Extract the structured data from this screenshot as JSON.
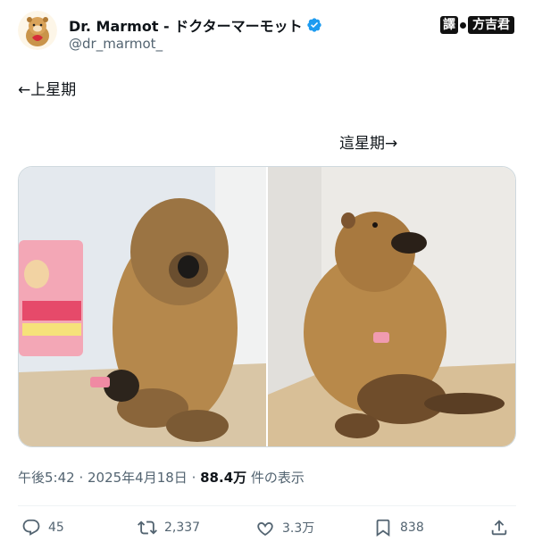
{
  "user": {
    "display_name": "Dr. Marmot - ドクターマーモット",
    "handle": "@dr_marmot_",
    "verified_icon": "verified-badge-icon"
  },
  "watermark": {
    "part1": "譯",
    "part2": "方吉君"
  },
  "tweet": {
    "line1": "←上星期",
    "line2": "這星期→"
  },
  "meta": {
    "time": "午後5:42",
    "sep1": " · ",
    "date": "2025年4月18日",
    "sep2": " · ",
    "views": "88.4万",
    "views_label": " 件の表示"
  },
  "actions": {
    "replies": "45",
    "retweets": "2,337",
    "likes": "3.3万",
    "bookmarks": "838"
  },
  "colors": {
    "accent": "#1d9bf0",
    "text": "#0f1419",
    "secondary": "#536471"
  }
}
